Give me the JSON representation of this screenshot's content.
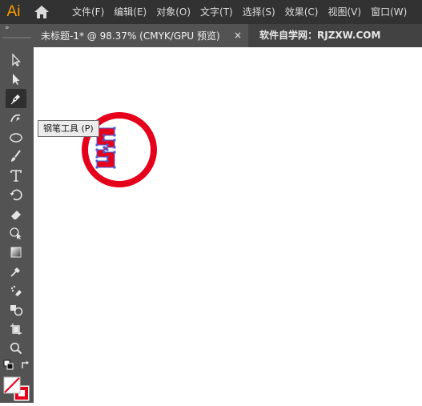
{
  "app": {
    "logo": "Ai",
    "logo_color": "#FF9A00",
    "home_icon": "home-icon"
  },
  "menu": [
    {
      "label": "文件(F)"
    },
    {
      "label": "编辑(E)"
    },
    {
      "label": "对象(O)"
    },
    {
      "label": "文字(T)"
    },
    {
      "label": "选择(S)"
    },
    {
      "label": "效果(C)"
    },
    {
      "label": "视图(V)"
    },
    {
      "label": "窗口(W)"
    }
  ],
  "tabs": {
    "active": {
      "title": "未标题-1* @ 98.37% (CMYK/GPU 预览)",
      "close": "×"
    },
    "second": {
      "title": "软件自学网：RJZXW.COM"
    }
  },
  "toolbar": {
    "collapse": "»",
    "active_tool": "pen-tool"
  },
  "tooltip": {
    "text": "钢笔工具 (P)"
  },
  "artwork": {
    "ring_color": "#E5001C",
    "shape_fill": "#E5001C",
    "selection_color": "#4B5BD6"
  }
}
